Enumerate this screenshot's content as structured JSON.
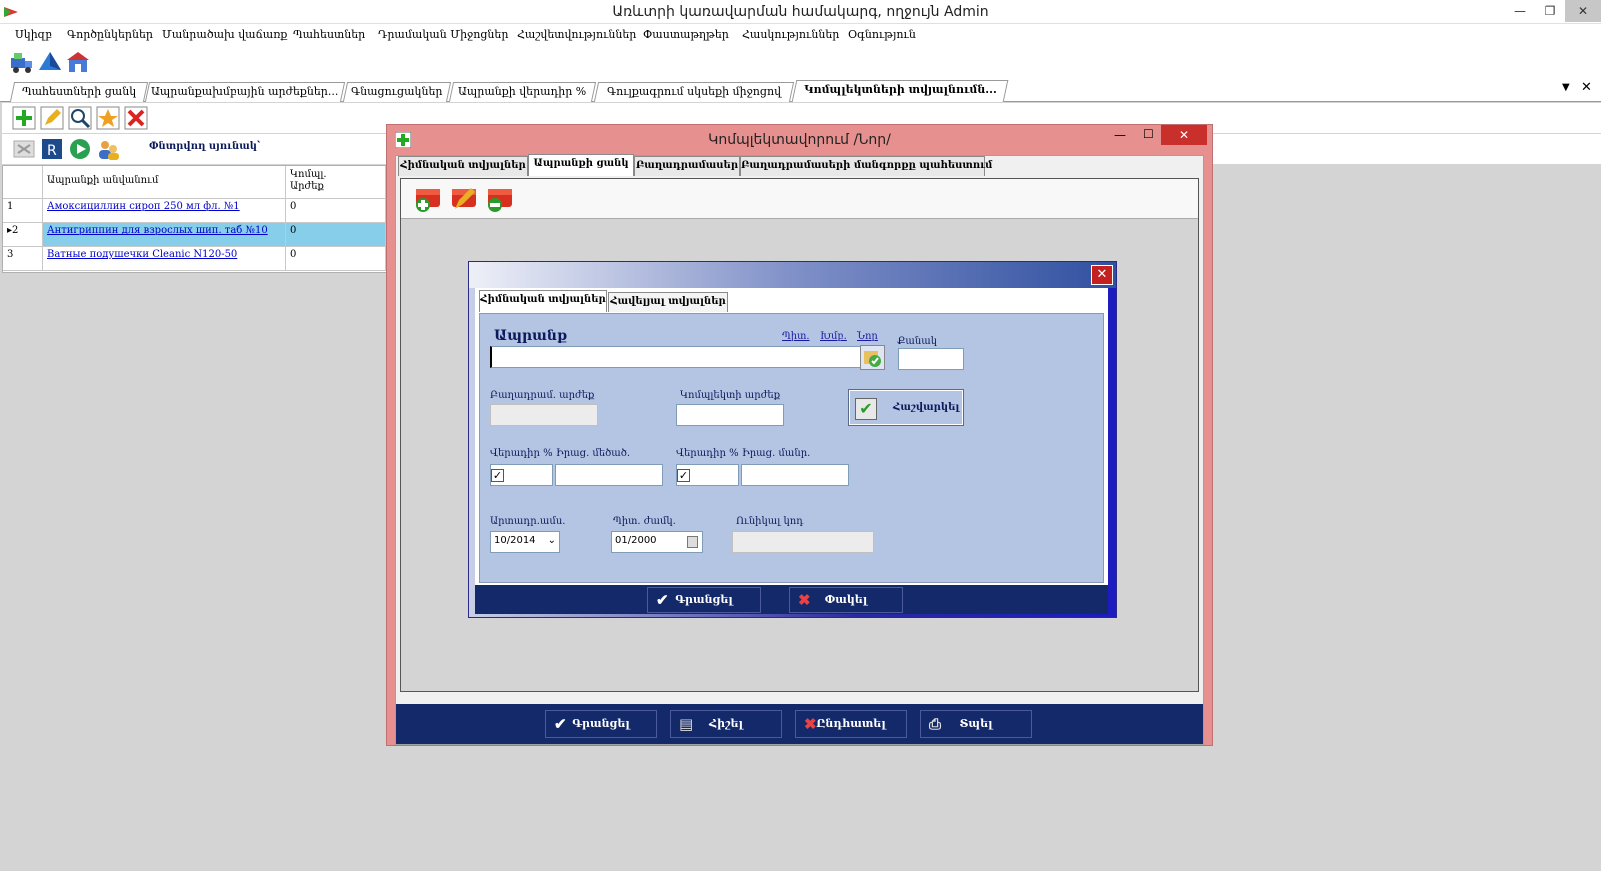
{
  "app": {
    "title": "Առևտրի կառավարման համակարգ, ողջույն Admin",
    "window_buttons": [
      "—",
      "❐",
      "✕"
    ]
  },
  "menu": [
    "Սկիզբ",
    "Գործընկերներ",
    "Մանրածախ վաճառք",
    "Պահեստներ",
    "Դրամական Միջոցներ",
    "Հաշվետվություններ",
    "Փաստաթղթեր",
    "Հասկություններ",
    "Օգնություն"
  ],
  "doc_tabs": [
    "Պահեստների ցանկ",
    "Ապրանքախմբային արժեքներ...",
    "Գնացուցակներ",
    "Ապրանքի վերադիր %",
    "Գուլքագրում սկսեքի միջոցով",
    "Կոմպլեկտների տվյալնումն..."
  ],
  "doc_tabs_controls": [
    "▼",
    "✕"
  ],
  "search_label": "Փնտրվող սյունակ՝",
  "grid": {
    "headers": [
      "Ապրանքի անվանում",
      "Կոմպլ.\nԱրժեք"
    ],
    "rows": [
      {
        "num": "1",
        "name": "Амоксициллин сироп 250 мл фл. №1",
        "value": "0",
        "selected": false
      },
      {
        "num": "2",
        "name": "Антигриппин для взрослых шип. таб №10",
        "value": "0",
        "selected": true
      },
      {
        "num": "3",
        "name": "Ватные подушечки Cleanic N120-50",
        "value": "0",
        "selected": false
      }
    ]
  },
  "dialog1": {
    "title": "Կոմպլեկտավորում /Նոր/",
    "window_buttons": [
      "—",
      "☐",
      "✕"
    ],
    "tabs": [
      "Հիմնական տվյալներ",
      "Ապրանքի ցանկ",
      "Բաղադրամասեր",
      "Բաղադրամասերի մանգորքը պահեստում"
    ],
    "footer": {
      "save": "Գրանցել",
      "print": "Հիշել",
      "cancel": "Ընդհատել",
      "send": "Տպել"
    }
  },
  "dialog2": {
    "tabs": [
      "Հիմնական տվյալներ",
      "Հավելյալ տվյալներ"
    ],
    "product_label": "Ապրանք",
    "links": [
      "Պիտ.",
      "Խմբ.",
      "Նոր"
    ],
    "qty_label": "Քանակ",
    "product_value": "",
    "qty_value": "",
    "component_value_label": "Բաղադրամ. արժեք",
    "kit_value_label": "Կոմպլեկտի արժեք",
    "calc_button": "Հաշվարկել",
    "markup_label_1": "Վերադիր %",
    "price_label_1": "Իրաց. մեծած.",
    "markup_label_2": "Վերադիր %",
    "price_label_2": "Իրաց. մանր.",
    "markup_checked_1": true,
    "markup_checked_2": true,
    "prod_date_label": "Արտադր.ամս.",
    "prod_date_value": "10/2014",
    "expiry_label": "Պիտ. ժամկ.",
    "expiry_value": "01/2000",
    "barcode_label": "Ունիկալ կոդ",
    "footer": {
      "save": "Գրանցել",
      "cancel": "Փակել"
    }
  },
  "colors": {
    "accent_dark": "#14296a",
    "dialog_frame": "#e6918f",
    "form_bg": "#b4c5e4",
    "selected_row": "#87ceeb"
  }
}
